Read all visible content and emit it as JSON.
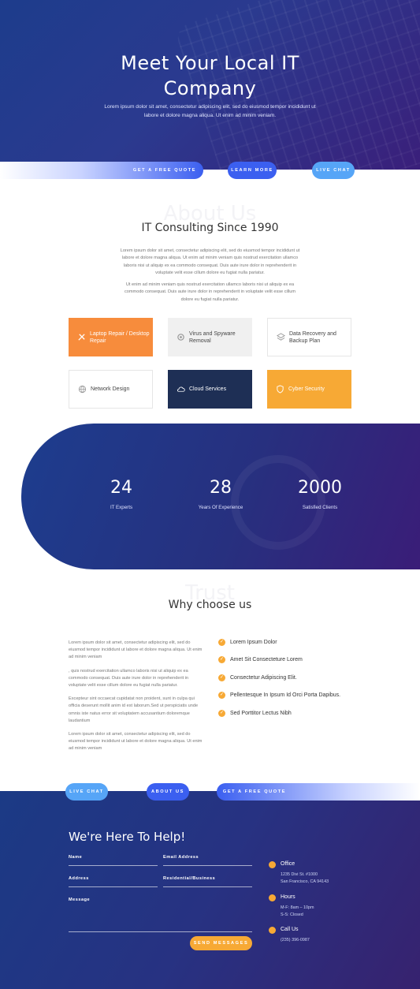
{
  "hero": {
    "title": "Meet Your Local IT\nCompany",
    "subtitle": "Lorem ipsum dolor sit amet, consectetur adipiscing elit, sed do eiusmod tempor incididunt ut labore et dolore magna aliqua. Ut enim ad minim veniam."
  },
  "buttons_top": {
    "quote": "GET A FREE QUOTE",
    "learn": "LEARN MORE",
    "chat": "LIVE CHAT"
  },
  "about": {
    "ghost": "About Us",
    "title": "IT Consulting Since 1990",
    "para1": "Lorem ipsum dolor sit amet, consectetur adipiscing elit, sed do eiusmod tempor incididunt ut labore et dolore magna aliqua. Ut enim ad minim veniam quis nostrud exercitation ullamco laboris nisi ut aliquip ex ea commodo consequat. Duis aute irure dolor in reprehenderit in voluptate velit esse cillum dolore eu fugiat nulla pariatur.",
    "para2": "Ut enim ad minim veniam quis nostrud exercitation ullamco laboris nisi ut aliquip ex ea commodo consequat. Duis aute irure dolor in reprehenderit in voluptate velit esse cillum dolore eu fugiat nulla pariatur."
  },
  "services": [
    {
      "label": "Laptop Repair / Desktop Repair",
      "icon": "tools-icon"
    },
    {
      "label": "Virus and Spyware Removal",
      "icon": "gear-icon"
    },
    {
      "label": "Data Recovery and Backup Plan",
      "icon": "layers-icon"
    },
    {
      "label": "Network Design",
      "icon": "globe-icon"
    },
    {
      "label": "Cloud Services",
      "icon": "cloud-icon"
    },
    {
      "label": "Cyber Security",
      "icon": "shield-icon"
    }
  ],
  "stats": [
    {
      "num": "24",
      "label": "IT Experts"
    },
    {
      "num": "28",
      "label": "Years Of Experience"
    },
    {
      "num": "2000",
      "label": "Satisfied Clients"
    }
  ],
  "why": {
    "ghost": "Trust",
    "title": "Why choose us",
    "p1": "Lorem ipsum dolor sit amet, consectetur adipiscing elit, sed do eiusmod tempor incididunt ut labore et dolore magna aliqua. Ut enim ad minim veniam",
    "p2": ", quis nostrud exercitation ullamco laboris nisi ut aliquip ex ea commodo consequat. Duis aute irure dolor in reprehenderit in voluptate velit esse cillum dolore eu fugiat nulla pariatur.",
    "p3": "Excepteur sint occaecat cupidatat non proident, sunt in culpa qui officia deserunt mollit anim id est laborum.Sed ut perspiciatis unde omnis iste natus error sit voluptatem accusantium doloremque laudantium",
    "p4": "Lorem ipsum dolor sit amet, consectetur adipiscing elit, sed do eiusmod tempor incididunt ut labore et dolore magna aliqua. Ut enim ad minim veniam",
    "checks": [
      "Lorem Ipsum Dolor",
      "Amet Sit Consecteture Lorem",
      "Consectetur Adipiscing Elit.",
      "Pellentesque In Ipsum Id Orci Porta Dapibus.",
      "Sed Porttitor Lectus Nibh"
    ]
  },
  "buttons_bottom": {
    "chat": "LIVE CHAT",
    "about": "ABOUT US",
    "quote": "GET A FREE QUOTE"
  },
  "contact": {
    "title": "We're Here To Help!",
    "name": "Name",
    "email": "Email Address",
    "address": "Address",
    "res": "Residential/Business",
    "message": "Message",
    "send": "SEND MESSAGES",
    "office_h": "Office",
    "office_t": "1235 Divi St. #1000\nSan Francisco, CA 94143",
    "hours_h": "Hours",
    "hours_t": "M-F: 8am – 10pm\nS-S: Closed",
    "call_h": "Call Us",
    "call_t": "(235) 396-0987"
  },
  "colors": {
    "orange": "#f7a935",
    "coral": "#f78c3c",
    "navy": "#1e2f55",
    "blue": "#3b5ff0",
    "sky": "#56a5f7"
  }
}
